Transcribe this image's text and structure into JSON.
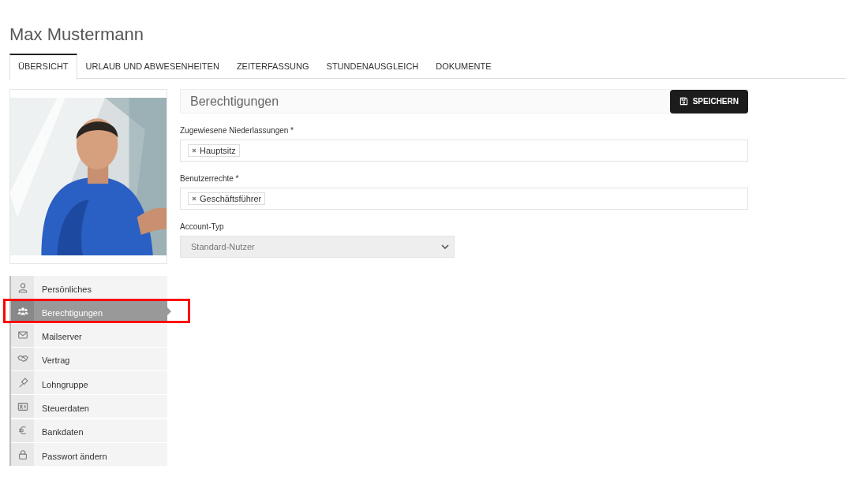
{
  "page_title": "Max Mustermann",
  "tabs": [
    {
      "label": "ÜBERSICHT",
      "selected": true
    },
    {
      "label": "URLAUB UND ABWESENHEITEN",
      "selected": false
    },
    {
      "label": "ZEITERFASSUNG",
      "selected": false
    },
    {
      "label": "STUNDENAUSGLEICH",
      "selected": false
    },
    {
      "label": "DOKUMENTE",
      "selected": false
    }
  ],
  "sidebar": {
    "items": [
      {
        "label": "Persönliches",
        "selected": false,
        "highlighted": false
      },
      {
        "label": "Berechtigungen",
        "selected": true,
        "highlighted": true
      },
      {
        "label": "Mailserver",
        "selected": false,
        "highlighted": false
      },
      {
        "label": "Vertrag",
        "selected": false,
        "highlighted": false
      },
      {
        "label": "Lohngruppe",
        "selected": false,
        "highlighted": false
      },
      {
        "label": "Steuerdaten",
        "selected": false,
        "highlighted": false
      },
      {
        "label": "Bankdaten",
        "selected": false,
        "highlighted": false
      },
      {
        "label": "Passwort ändern",
        "selected": false,
        "highlighted": false
      }
    ]
  },
  "panel": {
    "title": "Berechtigungen",
    "save_button": "SPEICHERN",
    "fields": [
      {
        "kind": "tags",
        "label": "Zugewiesene Niederlassungen *",
        "tags": [
          "Hauptsitz"
        ]
      },
      {
        "kind": "tags",
        "label": "Benutzerrechte *",
        "tags": [
          "Geschäftsführer"
        ]
      },
      {
        "kind": "select",
        "label": "Account-Typ",
        "value": "Standard-Nutzer",
        "disabled": true
      }
    ]
  }
}
